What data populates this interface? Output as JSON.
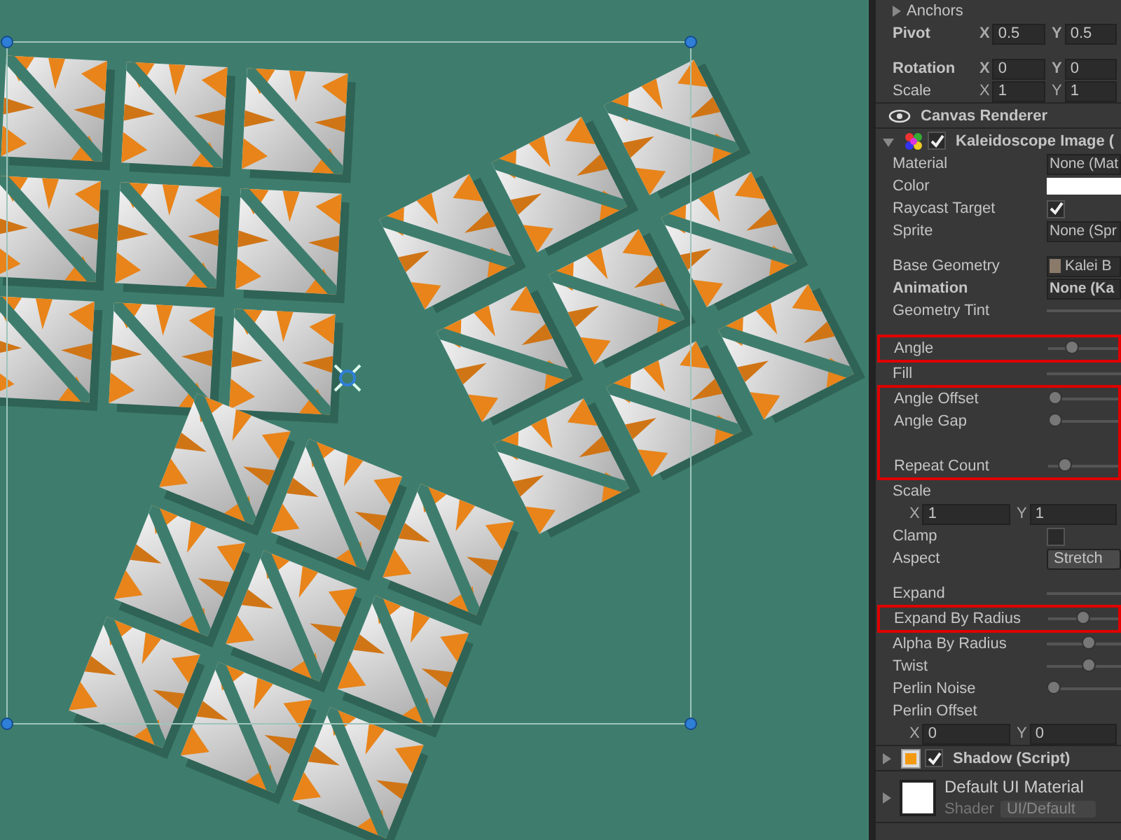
{
  "inspector": {
    "rows": [
      {
        "kind": "foldout",
        "label": "Anchors"
      },
      {
        "kind": "vector",
        "label": "Pivot",
        "bold": true,
        "axes": [
          {
            "axis": "X",
            "value": "0.5"
          },
          {
            "axis": "Y",
            "value": "0.5"
          }
        ]
      },
      {
        "kind": "spacer"
      },
      {
        "kind": "vector",
        "label": "Rotation",
        "bold": true,
        "axes": [
          {
            "axis": "X",
            "value": "0"
          },
          {
            "axis": "Y",
            "value": "0"
          }
        ]
      },
      {
        "kind": "vector",
        "label": "Scale",
        "bold": false,
        "axes": [
          {
            "axis": "X",
            "value": "1"
          },
          {
            "axis": "Y",
            "value": "1"
          }
        ]
      },
      {
        "kind": "component",
        "label": "Canvas Renderer"
      },
      {
        "kind": "component",
        "label": "Kaleidoscope Image (",
        "expanded": true,
        "enabled": true
      },
      {
        "kind": "object",
        "label": "Material",
        "value": "None (Mat"
      },
      {
        "kind": "color",
        "label": "Color",
        "color": "#ffffff"
      },
      {
        "kind": "checkbox",
        "label": "Raycast Target",
        "checked": true
      },
      {
        "kind": "object",
        "label": "Sprite",
        "value": "None (Spr"
      },
      {
        "kind": "spacer"
      },
      {
        "kind": "object",
        "label": "Base Geometry",
        "value": "Kalei B",
        "icon": true
      },
      {
        "kind": "object",
        "label": "Animation",
        "value": "None (Ka",
        "bold": true
      },
      {
        "kind": "track",
        "label": "Geometry Tint"
      },
      {
        "kind": "spacer"
      },
      {
        "kind": "group",
        "highlighted": true,
        "rows": [
          {
            "kind": "slider",
            "label": "Angle",
            "level": 0.34
          }
        ]
      },
      {
        "kind": "track",
        "label": "Fill"
      },
      {
        "kind": "group",
        "highlighted": true,
        "rows": [
          {
            "kind": "slider",
            "label": "Angle Offset",
            "level": 0.1
          },
          {
            "kind": "slider",
            "label": "Angle Gap",
            "level": 0.1
          },
          {
            "kind": "spacer"
          },
          {
            "kind": "slider",
            "label": "Repeat Count",
            "level": 0.24
          }
        ]
      },
      {
        "kind": "label",
        "label": "Scale"
      },
      {
        "kind": "vector",
        "label": "",
        "bold": false,
        "axes": [
          {
            "axis": "X",
            "value": "1"
          },
          {
            "axis": "Y",
            "value": "1"
          }
        ]
      },
      {
        "kind": "checkbox",
        "label": "Clamp",
        "checked": false
      },
      {
        "kind": "dropdown",
        "label": "Aspect",
        "value": "Stretch"
      },
      {
        "kind": "spacer"
      },
      {
        "kind": "track",
        "label": "Expand"
      },
      {
        "kind": "group",
        "highlighted": true,
        "rows": [
          {
            "kind": "slider",
            "label": "Expand By Radius",
            "level": 0.49
          }
        ]
      },
      {
        "kind": "slider",
        "label": "Alpha By Radius",
        "level": 0.57
      },
      {
        "kind": "slider",
        "label": "Twist",
        "level": 0.57
      },
      {
        "kind": "slider",
        "label": "Perlin Noise",
        "level": 0.1
      },
      {
        "kind": "label",
        "label": "Perlin Offset"
      },
      {
        "kind": "vector",
        "label": "",
        "bold": false,
        "axes": [
          {
            "axis": "X",
            "value": "0"
          },
          {
            "axis": "Y",
            "value": "0"
          }
        ]
      },
      {
        "kind": "component",
        "label": "Shadow (Script)",
        "expanded": false,
        "enabled": true
      },
      {
        "kind": "material",
        "name": "Default UI Material",
        "shader_label": "Shader",
        "shader": "UI/Default"
      }
    ]
  }
}
